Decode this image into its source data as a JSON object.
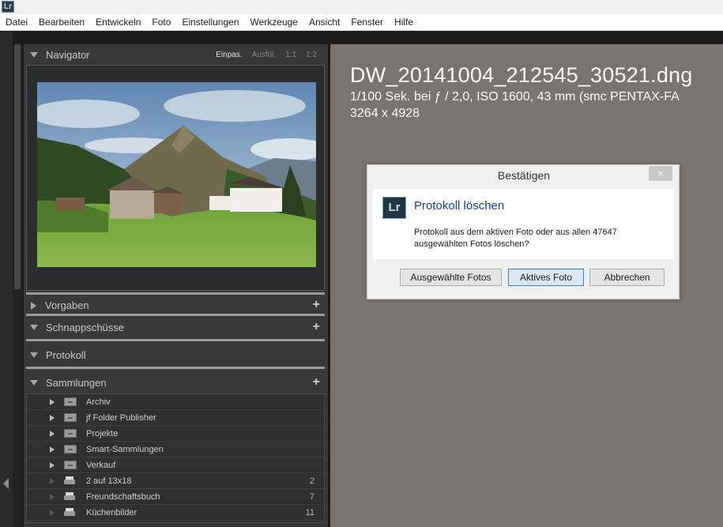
{
  "app": {
    "logo": "Lr"
  },
  "menu": [
    "Datei",
    "Bearbeiten",
    "Entwickeln",
    "Foto",
    "Einstellungen",
    "Werkzeuge",
    "Ansicht",
    "Fenster",
    "Hilfe"
  ],
  "navigator": {
    "title": "Navigator",
    "options": [
      "Einpas.",
      "Ausfül.",
      "1:1",
      "1:2"
    ],
    "active_option": "Einpas."
  },
  "panels": {
    "vorgaben": "Vorgaben",
    "schnappschuesse": "Schnappschüsse",
    "protokoll": "Protokoll",
    "sammlungen": "Sammlungen"
  },
  "collections": [
    {
      "name": "Archiv",
      "type": "set",
      "count": ""
    },
    {
      "name": "jf Folder Publisher",
      "type": "set",
      "count": ""
    },
    {
      "name": "Projekte",
      "type": "set",
      "count": ""
    },
    {
      "name": "Smart-Sammlungen",
      "type": "set",
      "count": ""
    },
    {
      "name": "Verkauf",
      "type": "set",
      "count": ""
    },
    {
      "name": "2 auf 13x18",
      "type": "print",
      "count": "2"
    },
    {
      "name": "Freundschaftsbuch",
      "type": "print",
      "count": "7"
    },
    {
      "name": "Küchenbilder",
      "type": "print",
      "count": "11"
    }
  ],
  "photo": {
    "filename": "DW_20141004_212545_30521.dng",
    "exposure": "1/100 Sek. bei ƒ / 2,0, ISO 1600, 43 mm (smc PENTAX-FA",
    "dimensions": "3264 x 4928"
  },
  "dialog": {
    "title": "Bestätigen",
    "close": "×",
    "icon": "Lr",
    "heading": "Protokoll löschen",
    "message_line1": "Protokoll aus dem aktiven Foto oder aus allen 47647",
    "message_line2": "ausgewählten Fotos löschen?",
    "buttons": {
      "selected": "Ausgewählte Fotos",
      "active": "Aktives Foto",
      "cancel": "Abbrechen"
    }
  }
}
